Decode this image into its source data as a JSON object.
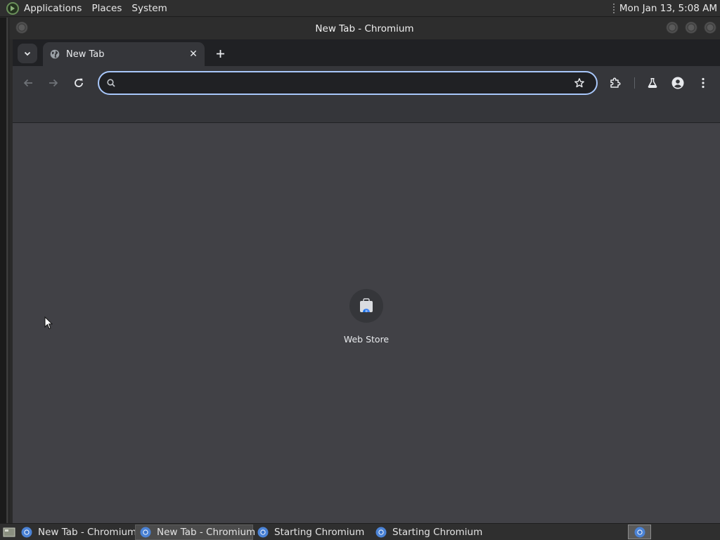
{
  "top_panel": {
    "menus": [
      "Applications",
      "Places",
      "System"
    ],
    "clock": "Mon Jan 13,  5:08 AM"
  },
  "window": {
    "title": "New Tab - Chromium"
  },
  "tabstrip": {
    "tabs": [
      {
        "title": "New Tab",
        "icon": "globe-icon",
        "close_label": "✕"
      }
    ],
    "new_tab_label": "+"
  },
  "toolbar": {
    "omnibox": {
      "value": "",
      "placeholder": ""
    },
    "buttons": [
      "back-icon",
      "forward-icon",
      "reload-icon",
      "star-icon",
      "extensions-icon",
      "labs-icon",
      "profile-icon",
      "menu-icon"
    ]
  },
  "content": {
    "shortcuts": [
      {
        "label": "Web Store",
        "icon": "web-store-icon"
      }
    ]
  },
  "taskbar": {
    "tasks": [
      {
        "label": "New Tab - Chromium",
        "active": false
      },
      {
        "label": "New Tab - Chromium",
        "active": true
      },
      {
        "label": "Starting Chromium",
        "active": false
      },
      {
        "label": "Starting Chromium",
        "active": false
      }
    ]
  },
  "colors": {
    "accent_focus": "#a8c7fa",
    "content_bg": "#414146",
    "toolbar_bg": "#35363a",
    "tabstrip_bg": "#202124"
  }
}
